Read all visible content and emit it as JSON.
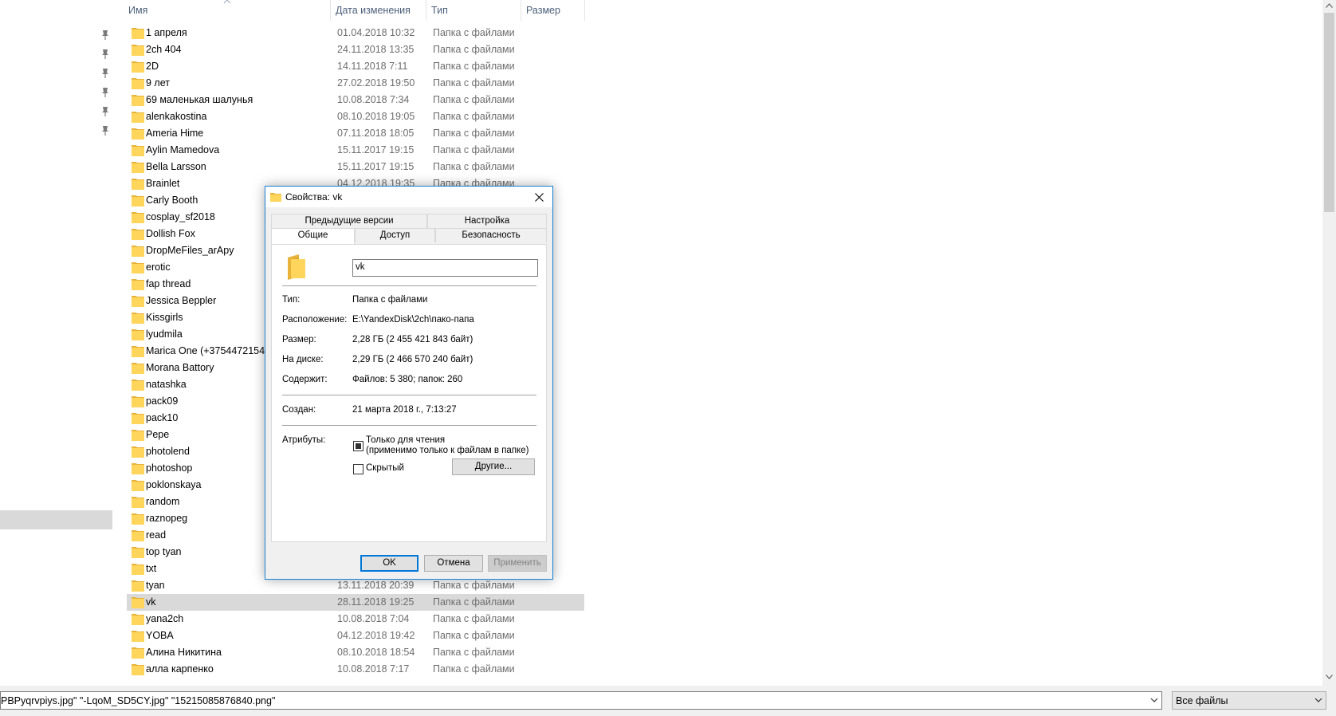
{
  "explorer": {
    "columns": {
      "name": "Имя",
      "date": "Дата изменения",
      "type": "Тип",
      "size": "Размер"
    },
    "rows": [
      {
        "name": "1 апреля",
        "date": "01.04.2018 10:32",
        "type": "Папка с файлами"
      },
      {
        "name": "2ch 404",
        "date": "24.11.2018 13:35",
        "type": "Папка с файлами"
      },
      {
        "name": "2D",
        "date": "14.11.2018 7:11",
        "type": "Папка с файлами"
      },
      {
        "name": "9 лет",
        "date": "27.02.2018 19:50",
        "type": "Папка с файлами"
      },
      {
        "name": "69 маленькая шалунья",
        "date": "10.08.2018 7:34",
        "type": "Папка с файлами"
      },
      {
        "name": "alenkakostina",
        "date": "08.10.2018 19:05",
        "type": "Папка с файлами"
      },
      {
        "name": "Ameria Hime",
        "date": "07.11.2018 18:05",
        "type": "Папка с файлами"
      },
      {
        "name": "Aylin Mamedova",
        "date": "15.11.2017 19:15",
        "type": "Папка с файлами"
      },
      {
        "name": "Bella Larsson",
        "date": "15.11.2017 19:15",
        "type": "Папка с файлами"
      },
      {
        "name": "Brainlet",
        "date": "04.12.2018 19:35",
        "type": "Папка с файлами"
      },
      {
        "name": "Carly Booth",
        "date": "",
        "type": ""
      },
      {
        "name": "cosplay_sf2018",
        "date": "",
        "type": ""
      },
      {
        "name": "Dollish Fox",
        "date": "",
        "type": ""
      },
      {
        "name": "DropMeFiles_arApy",
        "date": "",
        "type": ""
      },
      {
        "name": "erotic",
        "date": "",
        "type": ""
      },
      {
        "name": "fap thread",
        "date": "",
        "type": ""
      },
      {
        "name": "Jessica Beppler",
        "date": "",
        "type": ""
      },
      {
        "name": "Kissgirls",
        "date": "",
        "type": ""
      },
      {
        "name": "lyudmila",
        "date": "",
        "type": ""
      },
      {
        "name": "Marica One (+375447215443)",
        "date": "",
        "type": ""
      },
      {
        "name": "Morana Battory",
        "date": "",
        "type": ""
      },
      {
        "name": "natashka",
        "date": "",
        "type": ""
      },
      {
        "name": "pack09",
        "date": "",
        "type": ""
      },
      {
        "name": "pack10",
        "date": "",
        "type": ""
      },
      {
        "name": "Pepe",
        "date": "",
        "type": ""
      },
      {
        "name": "photolend",
        "date": "",
        "type": ""
      },
      {
        "name": "photoshop",
        "date": "",
        "type": ""
      },
      {
        "name": "poklonskaya",
        "date": "",
        "type": ""
      },
      {
        "name": "random",
        "date": "",
        "type": ""
      },
      {
        "name": "raznopeg",
        "date": "",
        "type": ""
      },
      {
        "name": "read",
        "date": "",
        "type": ""
      },
      {
        "name": "top tyan",
        "date": "",
        "type": ""
      },
      {
        "name": "txt",
        "date": "",
        "type": ""
      },
      {
        "name": "tyan",
        "date": "13.11.2018 20:39",
        "type": "Папка с файлами"
      },
      {
        "name": "vk",
        "date": "28.11.2018 19:25",
        "type": "Папка с файлами",
        "selected": true
      },
      {
        "name": "yana2ch",
        "date": "10.08.2018 7:04",
        "type": "Папка с файлами"
      },
      {
        "name": "YOBA",
        "date": "04.12.2018 19:42",
        "type": "Папка с файлами"
      },
      {
        "name": "Алина Никитина",
        "date": "08.10.2018 18:54",
        "type": "Папка с файлами"
      },
      {
        "name": "алла карпенко",
        "date": "10.08.2018 7:17",
        "type": "Папка с файлами"
      }
    ]
  },
  "bottom": {
    "filename_value": "PBPyqrvpiys.jpg\" \"-LqoM_SD5CY.jpg\" \"15215085876840.png\"",
    "filetype_value": "Все файлы"
  },
  "dialog": {
    "title": "Свойства: vk",
    "tabs_row1": [
      "Предыдущие версии",
      "Настройка"
    ],
    "tabs_row2": [
      "Общие",
      "Доступ",
      "Безопасность"
    ],
    "active_tab": "Общие",
    "name_value": "vk",
    "props": {
      "type_label": "Тип:",
      "type_value": "Папка с файлами",
      "location_label": "Расположение:",
      "location_value": "E:\\YandexDisk\\2ch\\пако-папа",
      "size_label": "Размер:",
      "size_value": "2,28 ГБ (2 455 421 843 байт)",
      "disk_label": "На диске:",
      "disk_value": "2,29 ГБ (2 466 570 240 байт)",
      "contains_label": "Содержит:",
      "contains_value": "Файлов: 5 380; папок: 260",
      "created_label": "Создан:",
      "created_value": "21 марта 2018 г., 7:13:27",
      "attributes_label": "Атрибуты:"
    },
    "readonly_label": "Только для чтения",
    "readonly_note": "(применимо только к файлам в папке)",
    "hidden_label": "Скрытый",
    "other_button": "Другие...",
    "ok_button": "OK",
    "cancel_button": "Отмена",
    "apply_button": "Применить"
  },
  "colors": {
    "folder": "#ffd55c",
    "folder_dark": "#e8b33b",
    "selection": "#d9d9d9",
    "accent": "#0078d7"
  }
}
